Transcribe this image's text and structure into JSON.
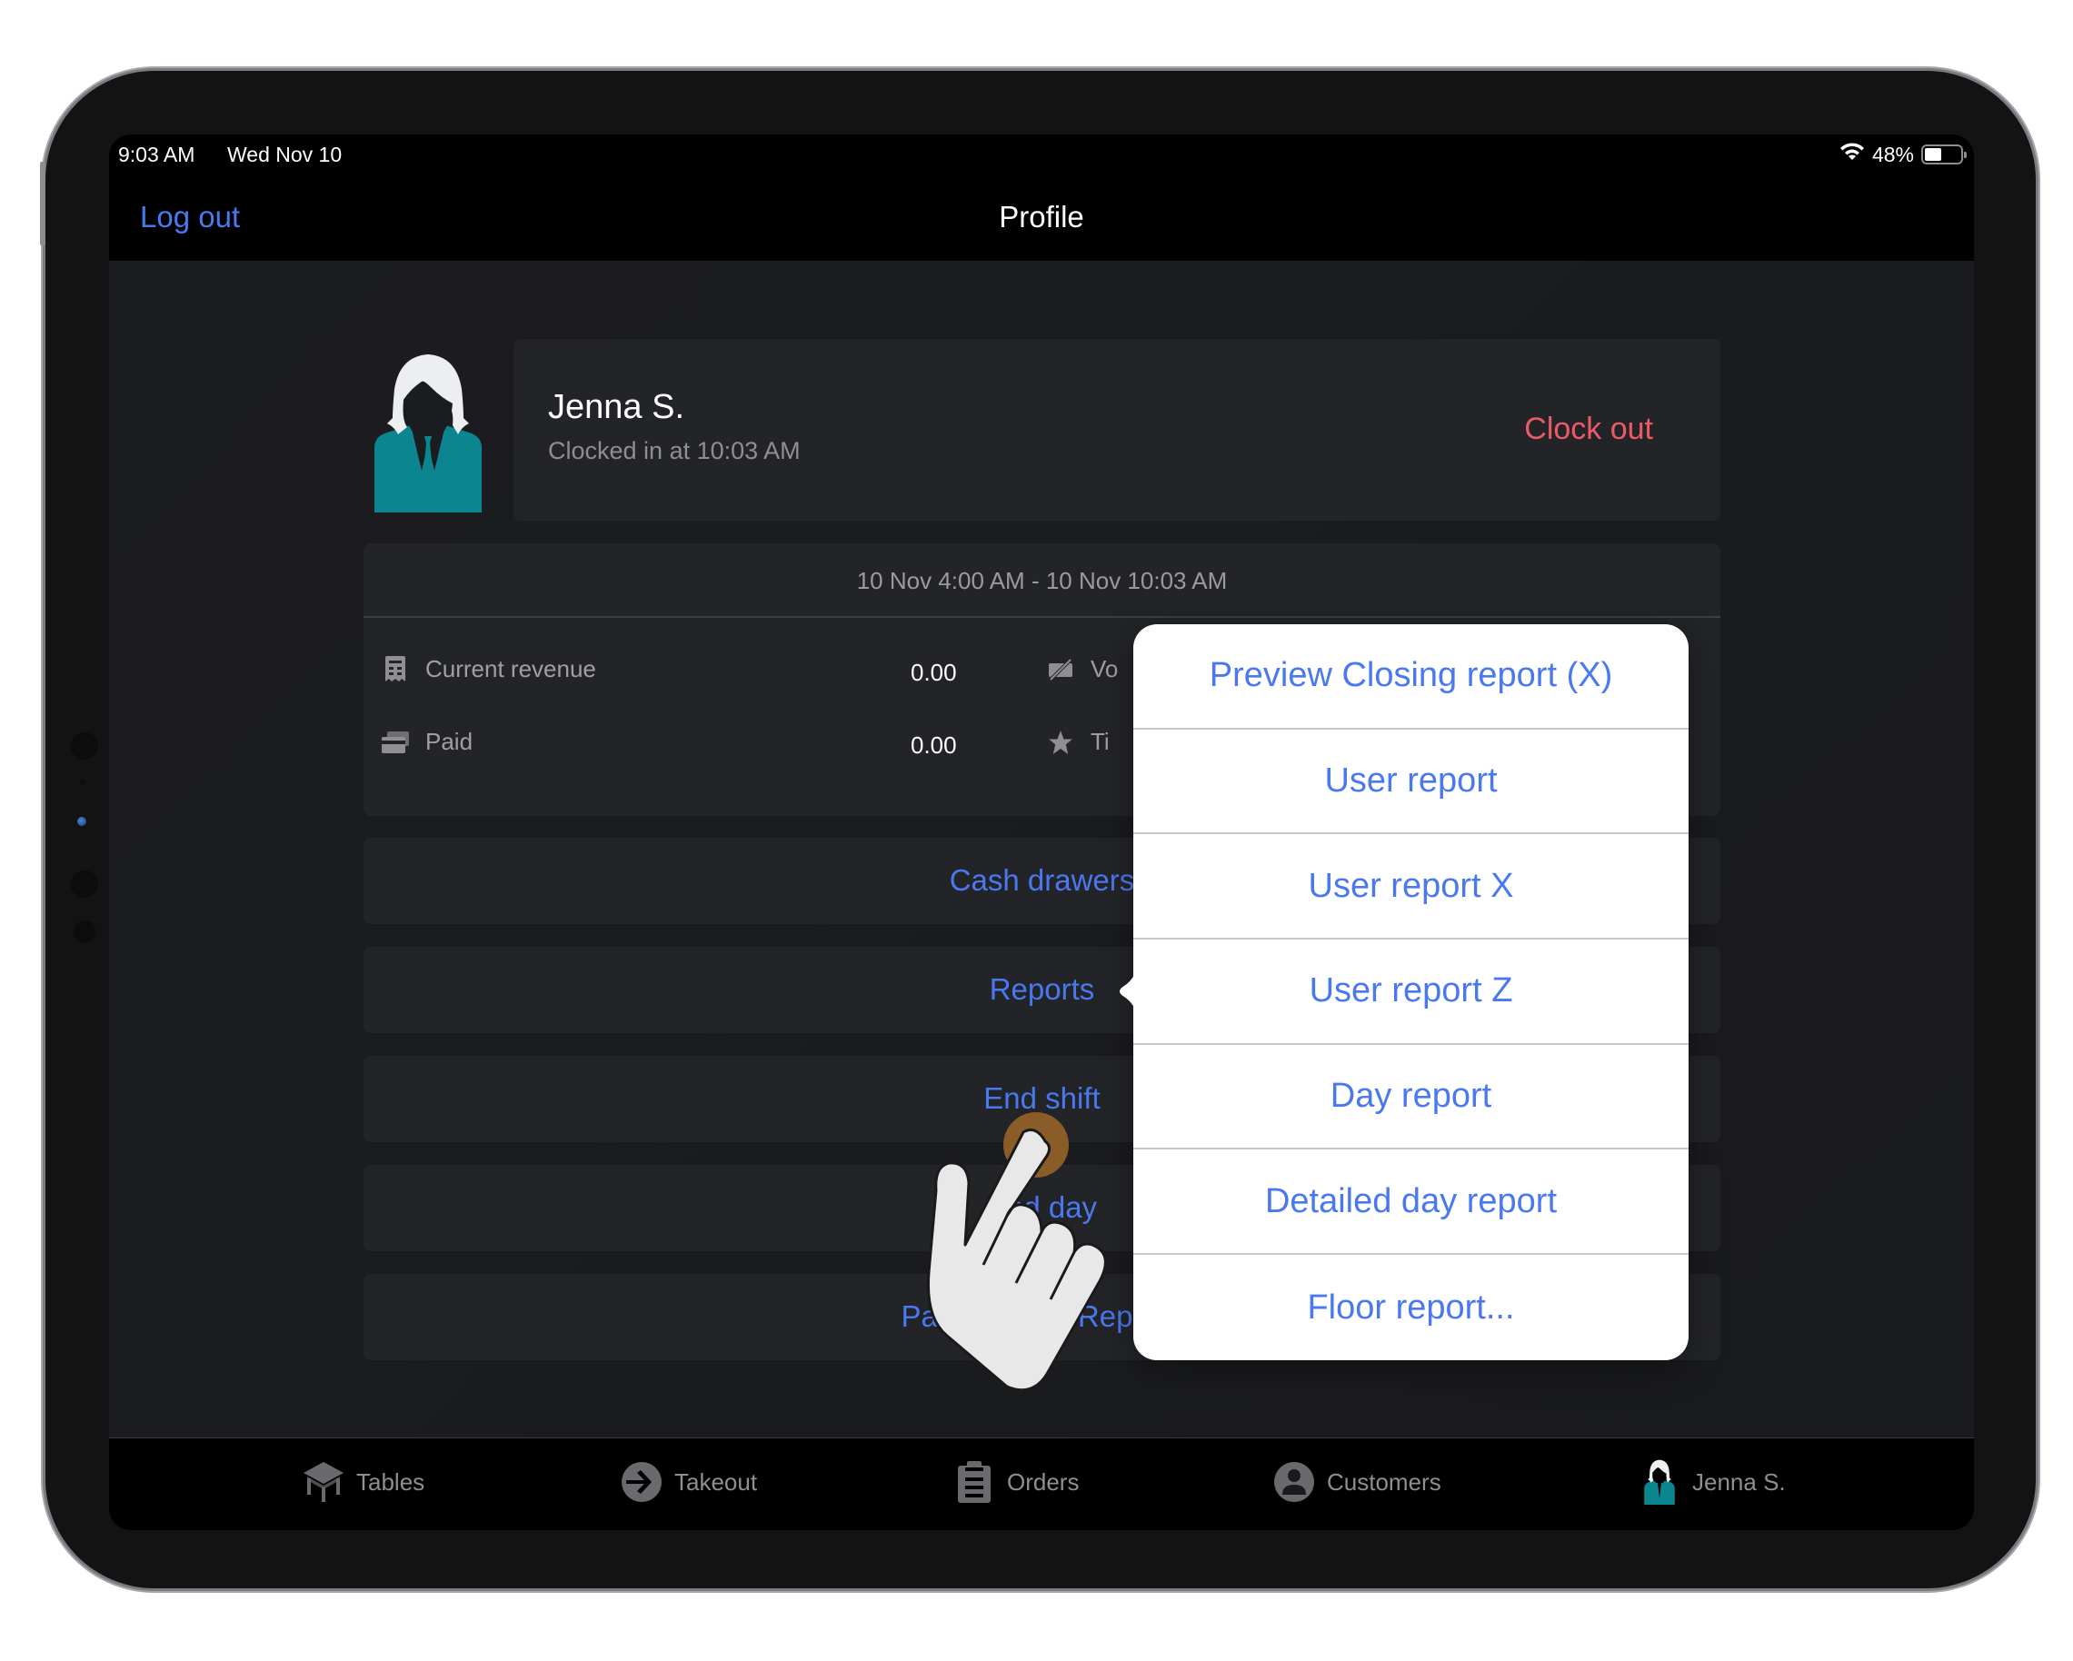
{
  "status_bar": {
    "time": "9:03 AM",
    "date": "Wed Nov 10",
    "battery_percent_label": "48%",
    "battery_level": 0.48,
    "wifi_icon": "wifi-icon",
    "battery_icon": "battery-icon"
  },
  "nav_bar": {
    "left_button": "Log out",
    "title": "Profile"
  },
  "profile": {
    "name": "Jenna S.",
    "status": "Clocked in at 10:03 AM",
    "clock_out_label": "Clock out",
    "avatar_icon": "user-avatar-icon"
  },
  "stats": {
    "range": "10 Nov 4:00 AM - 10 Nov 10:03 AM",
    "rows": [
      {
        "icon": "receipt-icon",
        "label": "Current revenue",
        "value": "0.00"
      },
      {
        "icon": "cards-icon",
        "label": "Paid",
        "value": "0.00"
      }
    ],
    "right_rows": [
      {
        "icon": "void-ticket-icon",
        "label_visible": "Vo"
      },
      {
        "icon": "star-icon",
        "label_visible": "Ti"
      }
    ]
  },
  "actions": [
    {
      "label": "Cash drawers"
    },
    {
      "label": "Reports"
    },
    {
      "label": "End shift"
    },
    {
      "label": "End day"
    },
    {
      "label": "Past Closing Reports"
    }
  ],
  "popover": {
    "anchor": "Reports",
    "items": [
      {
        "label": "Preview Closing report (X)"
      },
      {
        "label": "User report"
      },
      {
        "label": "User report X"
      },
      {
        "label": "User report Z"
      },
      {
        "label": "Day report"
      },
      {
        "label": "Detailed day report"
      },
      {
        "label": "Floor report..."
      }
    ]
  },
  "tab_bar": {
    "tabs": [
      {
        "label": "Tables",
        "icon": "table-icon"
      },
      {
        "label": "Takeout",
        "icon": "arrow-circle-icon"
      },
      {
        "label": "Orders",
        "icon": "clipboard-icon"
      },
      {
        "label": "Customers",
        "icon": "person-circle-icon"
      },
      {
        "label": "Jenna S.",
        "icon": "user-avatar-icon"
      }
    ]
  },
  "colors": {
    "accent": "#4a78ee",
    "destructive": "#ec5a65",
    "avatar_teal": "#0b858f",
    "touch_indicator": "#8a5c27"
  }
}
